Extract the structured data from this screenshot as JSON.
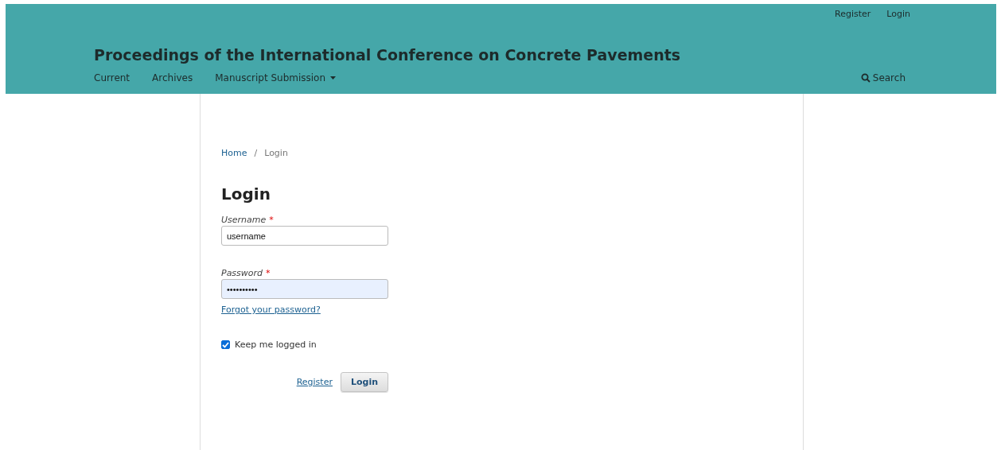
{
  "header": {
    "user_links": [
      "Register",
      "Login"
    ],
    "site_title": "Proceedings of the International Conference on Concrete Pavements",
    "nav": [
      {
        "label": "Current",
        "dropdown": false
      },
      {
        "label": "Archives",
        "dropdown": false
      },
      {
        "label": "Manuscript Submission",
        "dropdown": true
      }
    ],
    "search": "Search"
  },
  "breadcrumb": {
    "items": [
      "Home",
      "Login"
    ],
    "separator": "/"
  },
  "heading": "Login",
  "fields": [
    {
      "label": "Username",
      "required_mark": "*",
      "value": "username",
      "focused": false
    },
    {
      "label": "Password",
      "required_mark": "*",
      "value": "••••••••••",
      "focused": true
    }
  ],
  "forgot_link": "Forgot your password?",
  "remember": {
    "label": "Keep me logged in",
    "checked": true
  },
  "actions": {
    "register": "Register",
    "login": "Login"
  }
}
